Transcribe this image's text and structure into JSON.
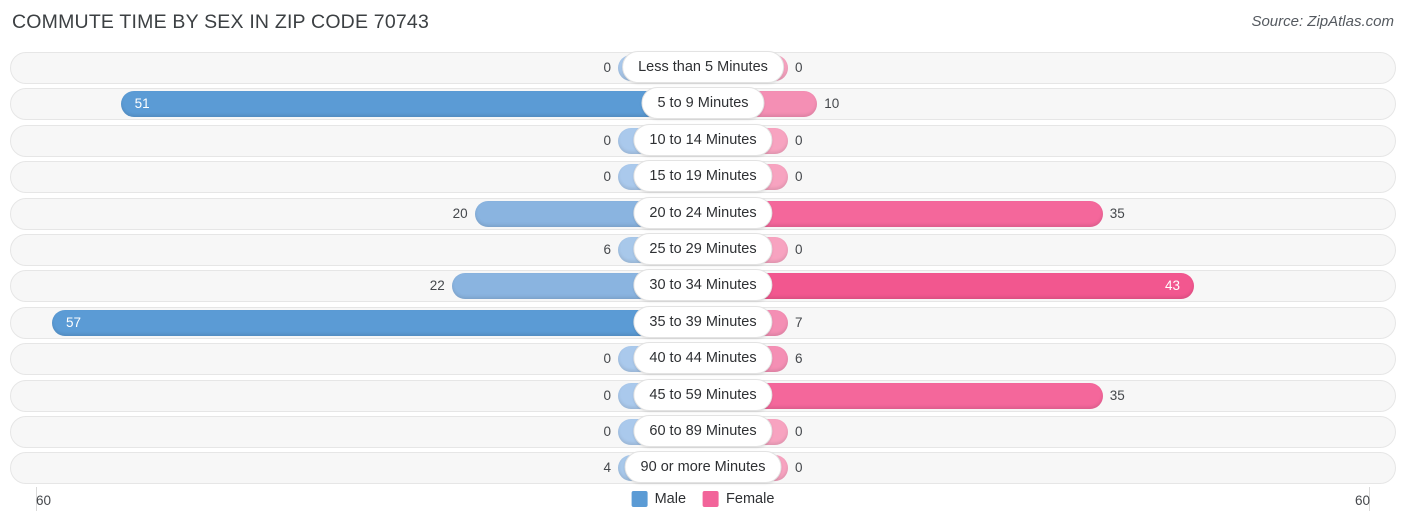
{
  "header": {
    "title": "COMMUTE TIME BY SEX IN ZIP CODE 70743",
    "source": "Source: ZipAtlas.com"
  },
  "legend": {
    "items": [
      {
        "label": "Male",
        "color": "#5b9bd5",
        "icon": "male-swatch"
      },
      {
        "label": "Female",
        "color": "#f2649a",
        "icon": "female-swatch"
      }
    ]
  },
  "axis": {
    "left_label": "60",
    "right_label": "60",
    "max": 60
  },
  "chart_data": {
    "type": "bar",
    "title": "COMMUTE TIME BY SEX IN ZIP CODE 70743",
    "subtitle": "Source: ZipAtlas.com",
    "orientation": "horizontal-diverging",
    "xlabel": "",
    "ylabel": "",
    "xlim": [
      60,
      60
    ],
    "grid": false,
    "legend_position": "bottom-center",
    "categories": [
      "Less than 5 Minutes",
      "5 to 9 Minutes",
      "10 to 14 Minutes",
      "15 to 19 Minutes",
      "20 to 24 Minutes",
      "25 to 29 Minutes",
      "30 to 34 Minutes",
      "35 to 39 Minutes",
      "40 to 44 Minutes",
      "45 to 59 Minutes",
      "60 to 89 Minutes",
      "90 or more Minutes"
    ],
    "series": [
      {
        "name": "Male",
        "color": "#5b9bd5",
        "values": [
          0,
          51,
          0,
          0,
          20,
          6,
          22,
          57,
          0,
          0,
          0,
          4
        ]
      },
      {
        "name": "Female",
        "color": "#f2649a",
        "values": [
          0,
          10,
          0,
          0,
          35,
          0,
          43,
          7,
          6,
          35,
          0,
          0
        ]
      }
    ]
  },
  "rows": [
    {
      "label": "Less than 5 Minutes",
      "male": "0",
      "female": "0"
    },
    {
      "label": "5 to 9 Minutes",
      "male": "51",
      "female": "10"
    },
    {
      "label": "10 to 14 Minutes",
      "male": "0",
      "female": "0"
    },
    {
      "label": "15 to 19 Minutes",
      "male": "0",
      "female": "0"
    },
    {
      "label": "20 to 24 Minutes",
      "male": "20",
      "female": "35"
    },
    {
      "label": "25 to 29 Minutes",
      "male": "6",
      "female": "0"
    },
    {
      "label": "30 to 34 Minutes",
      "male": "22",
      "female": "43"
    },
    {
      "label": "35 to 39 Minutes",
      "male": "57",
      "female": "7"
    },
    {
      "label": "40 to 44 Minutes",
      "male": "0",
      "female": "6"
    },
    {
      "label": "45 to 59 Minutes",
      "male": "0",
      "female": "35"
    },
    {
      "label": "60 to 89 Minutes",
      "male": "0",
      "female": "0"
    },
    {
      "label": "90 or more Minutes",
      "male": "4",
      "female": "0"
    }
  ]
}
